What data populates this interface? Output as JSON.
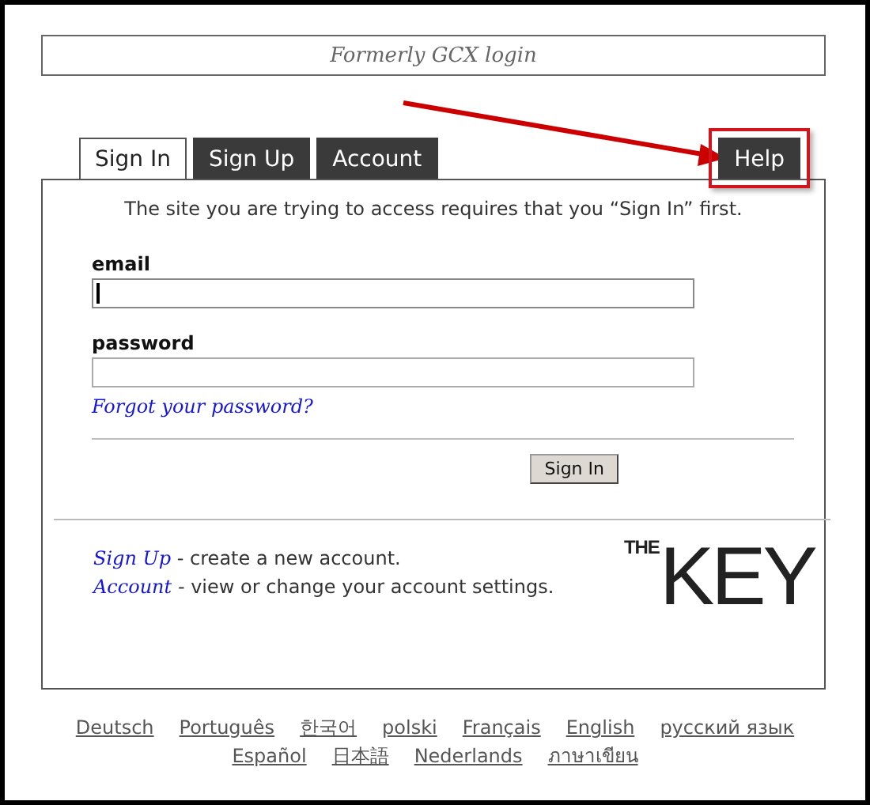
{
  "header": {
    "text": "Formerly GCX login"
  },
  "tabs": [
    {
      "label": "Sign In",
      "selected": true
    },
    {
      "label": "Sign Up",
      "selected": false
    },
    {
      "label": "Account",
      "selected": false
    }
  ],
  "help_tab": {
    "label": "Help",
    "selected": false,
    "highlighted": true
  },
  "notice": "The site you are trying to access requires that you “Sign In” first.",
  "fields": [
    {
      "label": "email",
      "focused": true
    },
    {
      "label": "password",
      "focused": false
    }
  ],
  "forgot_link": "Forgot your password?",
  "submit_button": "Sign In",
  "links": [
    {
      "link": "Sign Up",
      "text": " - create a new account."
    },
    {
      "link": "Account",
      "text": " - view or change your account settings."
    }
  ],
  "logo": {
    "small": "THE",
    "large": "KEY"
  },
  "languages": [
    [
      "Deutsch",
      "Português",
      "한국어",
      "polski",
      "Français",
      "English",
      "русский язык"
    ],
    [
      "Español",
      "日本語",
      "Nederlands",
      "ภาษาเขียน"
    ]
  ]
}
